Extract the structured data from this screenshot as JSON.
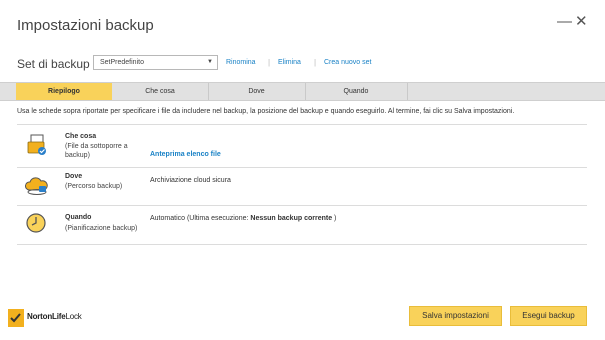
{
  "window": {
    "title": "Impostazioni backup",
    "minimize_glyph": "—",
    "close_glyph": "✕"
  },
  "backup_set": {
    "label": "Set di backup",
    "selected": "SetPredefinito",
    "links": {
      "rename": "Rinomina",
      "delete": "Elimina",
      "create": "Crea nuovo set"
    }
  },
  "tabs": [
    {
      "label": "Riepilogo",
      "active": true
    },
    {
      "label": "Che cosa",
      "active": false
    },
    {
      "label": "Dove",
      "active": false
    },
    {
      "label": "Quando",
      "active": false
    }
  ],
  "instructions": "Usa le schede sopra riportate per specificare i file da includere nel backup, la posizione del backup e quando eseguirlo. Al termine, fai clic su Salva impostazioni.",
  "summary": {
    "what": {
      "icon": "file-folder-icon",
      "title": "Che cosa",
      "subtitle_1": "(File da sottoporre a",
      "subtitle_2": "backup)",
      "link": "Anteprima elenco file"
    },
    "where": {
      "icon": "cloud-storage-icon",
      "title": "Dove",
      "subtitle": "(Percorso backup)",
      "value": "Archiviazione cloud sicura"
    },
    "when": {
      "icon": "clock-icon",
      "title": "Quando",
      "subtitle": "(Pianificazione backup)",
      "value_prefix": "Automatico   (Ultima esecuzione: ",
      "value_bold": "Nessun backup corrente",
      "value_suffix": " )"
    }
  },
  "footer": {
    "brand_bold": "NortonLife",
    "brand_rest": "Lock",
    "save_button": "Salva impostazioni",
    "run_button": "Esegui backup"
  },
  "colors": {
    "accent": "#f9d25a",
    "link": "#1a82c6"
  }
}
